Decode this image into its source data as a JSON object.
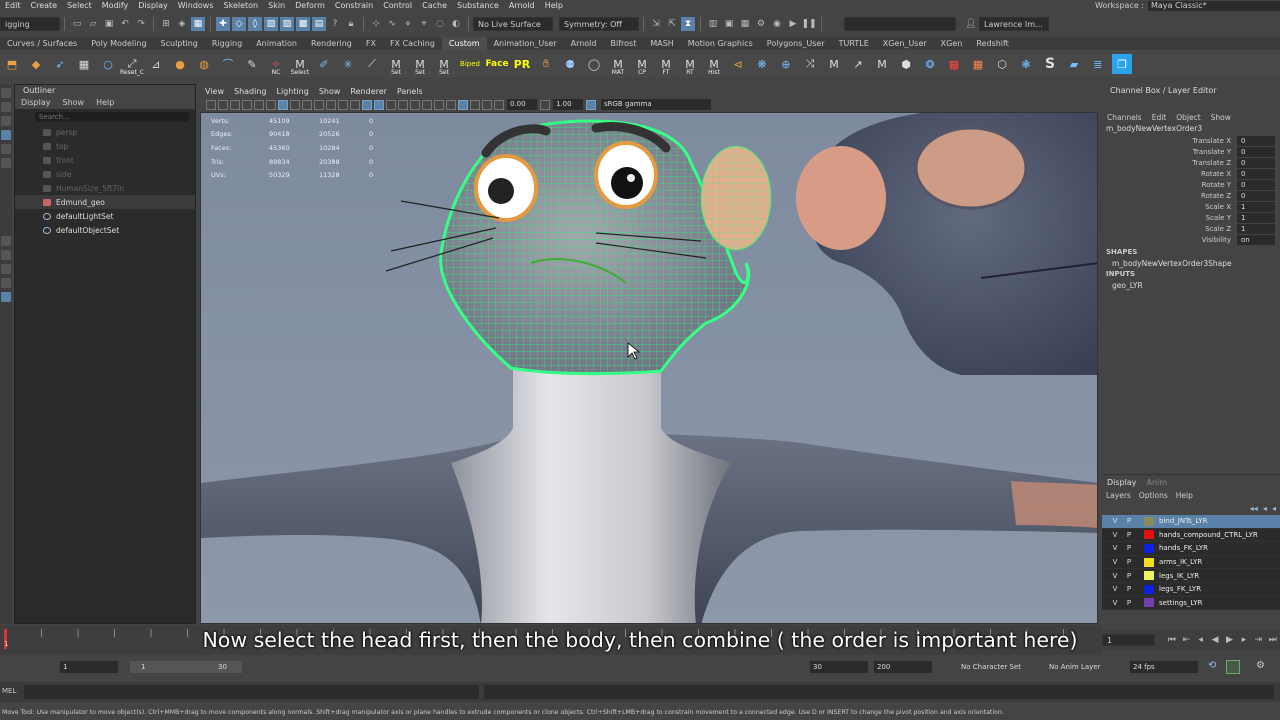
{
  "menubar": {
    "items": [
      "Edit",
      "Create",
      "Select",
      "Modify",
      "Display",
      "Windows",
      "Skeleton",
      "Skin",
      "Deform",
      "Constrain",
      "Control",
      "Cache",
      "Substance",
      "Arnold",
      "Help"
    ],
    "workspace_label": "Workspace :",
    "workspace_value": "Maya Classic*"
  },
  "statusline": {
    "menuset": "igging",
    "live_surface": "No Live Surface",
    "symmetry": "Symmetry: Off",
    "user": "Lawrence Im..."
  },
  "shelf_tabs": [
    "Curves / Surfaces",
    "Poly Modeling",
    "Sculpting",
    "Rigging",
    "Animation",
    "Rendering",
    "FX",
    "FX Caching",
    "Custom",
    "Animation_User",
    "Arnold",
    "Bifrost",
    "MASH",
    "Motion Graphics",
    "Polygons_User",
    "TURTLE",
    "XGen_User",
    "XGen",
    "Redshift"
  ],
  "shelf_active": "Custom",
  "shelf_labels": {
    "reset": "Reset_C",
    "select": "Select",
    "nc": "NC",
    "set1": "Set",
    "set2": "Set",
    "set3": "Set",
    "biped": "Biped",
    "face": "Face",
    "pr": "PR",
    "mat": "MAT",
    "cp": "CP",
    "ft": "FT",
    "rt": "RT",
    "hist": "Hist",
    "s": "S"
  },
  "outliner": {
    "title": "Outliner",
    "menu": [
      "Display",
      "Show",
      "Help"
    ],
    "search_placeholder": "Search...",
    "items": [
      {
        "label": "persp",
        "dim": true
      },
      {
        "label": "top",
        "dim": true
      },
      {
        "label": "front",
        "dim": true
      },
      {
        "label": "side",
        "dim": true
      },
      {
        "label": "HumanSize_5ft7in",
        "dim": true
      },
      {
        "label": "Edmund_geo",
        "dim": false
      },
      {
        "label": "defaultLightSet",
        "dim": false
      },
      {
        "label": "defaultObjectSet",
        "dim": false
      }
    ]
  },
  "viewport": {
    "menu": [
      "View",
      "Shading",
      "Lighting",
      "Show",
      "Renderer",
      "Panels"
    ],
    "exposure": "0.00",
    "gamma": "1.00",
    "color_space": "sRGB gamma",
    "hud": [
      {
        "label": "Verts:",
        "a": "45109",
        "b": "10241",
        "c": "0"
      },
      {
        "label": "Edges:",
        "a": "90418",
        "b": "20526",
        "c": "0"
      },
      {
        "label": "Faces:",
        "a": "45360",
        "b": "10284",
        "c": "0"
      },
      {
        "label": "Tris:",
        "a": "89834",
        "b": "20388",
        "c": "0"
      },
      {
        "label": "UVs:",
        "a": "50329",
        "b": "11328",
        "c": "0"
      }
    ]
  },
  "channel_box": {
    "title": "Channel Box / Layer Editor",
    "menu": [
      "Channels",
      "Edit",
      "Object",
      "Show"
    ],
    "object": "m_bodyNewVertexOrder3",
    "attrs": [
      {
        "name": "Translate X",
        "value": "0"
      },
      {
        "name": "Translate Y",
        "value": "0"
      },
      {
        "name": "Translate Z",
        "value": "0"
      },
      {
        "name": "Rotate X",
        "value": "0"
      },
      {
        "name": "Rotate Y",
        "value": "0"
      },
      {
        "name": "Rotate Z",
        "value": "0"
      },
      {
        "name": "Scale X",
        "value": "1"
      },
      {
        "name": "Scale Y",
        "value": "1"
      },
      {
        "name": "Scale Z",
        "value": "1"
      },
      {
        "name": "Visibility",
        "value": "on"
      }
    ],
    "shapes_label": "SHAPES",
    "shape_name": "m_bodyNewVertexOrder3Shape",
    "inputs_label": "INPUTS",
    "input_name": "geo_LYR"
  },
  "layer_editor": {
    "tabs": [
      "Display",
      "Anim"
    ],
    "menu": [
      "Layers",
      "Options",
      "Help"
    ],
    "layers": [
      {
        "v": "V",
        "p": "P",
        "name": "bind_JNTs_LYR",
        "color": "#8a8a5a",
        "selected": true
      },
      {
        "v": "V",
        "p": "P",
        "name": "hands_compound_CTRL_LYR",
        "color": "#e01010",
        "selected": false
      },
      {
        "v": "V",
        "p": "P",
        "name": "hands_FK_LYR",
        "color": "#1020e0",
        "selected": false
      },
      {
        "v": "V",
        "p": "P",
        "name": "arms_IK_LYR",
        "color": "#f0e020",
        "selected": false
      },
      {
        "v": "V",
        "p": "P",
        "name": "legs_IK_LYR",
        "color": "#f0f060",
        "selected": false
      },
      {
        "v": "V",
        "p": "P",
        "name": "legs_FK_LYR",
        "color": "#1020e0",
        "selected": false
      },
      {
        "v": "V",
        "p": "P",
        "name": "settings_LYR",
        "color": "#7040b0",
        "selected": false
      }
    ]
  },
  "timeline": {
    "current_frame": "1",
    "tick_start": "1",
    "frame_field": "1"
  },
  "subtitle": "Now select the head first, then the body, then combine ( the order is important here)",
  "range": {
    "start": "1",
    "range_start": "1",
    "range_end": "30",
    "end": "30",
    "max": "200",
    "char_set": "No Character Set",
    "anim_layer": "No Anim Layer",
    "fps": "24 fps"
  },
  "mel": {
    "label": "MEL"
  },
  "helpline": "Move Tool: Use manipulator to move object(s). Ctrl+MMB+drag to move components along normals. Shift+drag manipulator axis or plane handles to extrude components or clone objects. Ctrl+Shift+LMB+drag to constrain movement to a connected edge. Use D or INSERT to change the pivot position and axis orientation."
}
